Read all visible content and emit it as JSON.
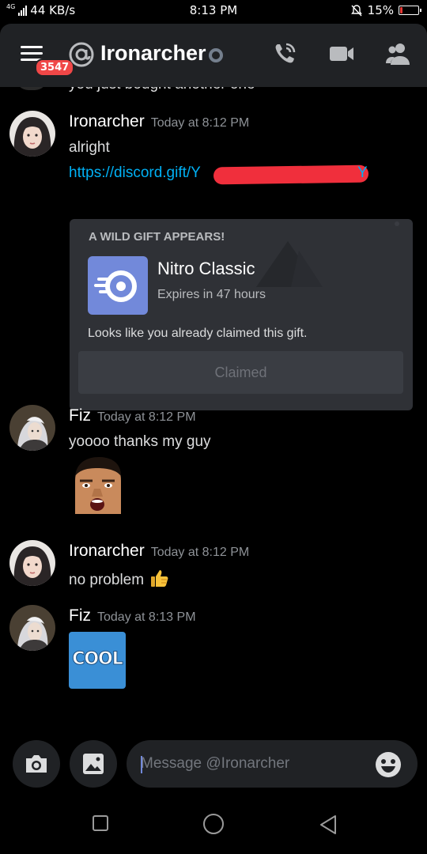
{
  "status_bar": {
    "network": "4G",
    "speed": "44 KB/s",
    "time": "8:13 PM",
    "battery": "15%",
    "battery_level": 0.15
  },
  "header": {
    "unread_badge": "3547",
    "title": "Ironarcher",
    "icons": [
      "hamburger-menu-icon",
      "at-icon",
      "status-dot-icon",
      "phone-call-icon",
      "video-call-icon",
      "members-icon"
    ]
  },
  "messages": [
    {
      "author": "Ironarcher",
      "timestamp": "Today at 8:12 PM",
      "lines": [
        "alright"
      ],
      "link": "https://discord.gift/Y",
      "link_tail": "Y",
      "gift": {
        "heading": "A WILD GIFT APPEARS!",
        "name": "Nitro Classic",
        "expires": "Expires in 47 hours",
        "note": "Looks like you already claimed this gift.",
        "button": "Claimed"
      }
    },
    {
      "author": "Fiz",
      "timestamp": "Today at 8:12 PM",
      "lines": [
        "yoooo thanks my guy"
      ],
      "emote": "surprised-face-emote"
    },
    {
      "author": "Ironarcher",
      "timestamp": "Today at 8:12 PM",
      "lines": [
        "no problem"
      ],
      "emoji": "thumbs-up"
    },
    {
      "author": "Fiz",
      "timestamp": "Today at 8:13 PM",
      "emote": "cool-emote",
      "emote_text": "COOL"
    }
  ],
  "composer": {
    "placeholder": "Message @Ironarcher",
    "icons": [
      "camera-icon",
      "image-icon",
      "emoji-icon"
    ]
  },
  "nav": {
    "icons": [
      "recents-square-icon",
      "home-circle-icon",
      "back-triangle-icon"
    ]
  },
  "colors": {
    "background": "#000000",
    "header": "#202225",
    "embed": "#2f3136",
    "link": "#00b0f4",
    "badge": "#f04747",
    "nitro": "#7289da"
  }
}
